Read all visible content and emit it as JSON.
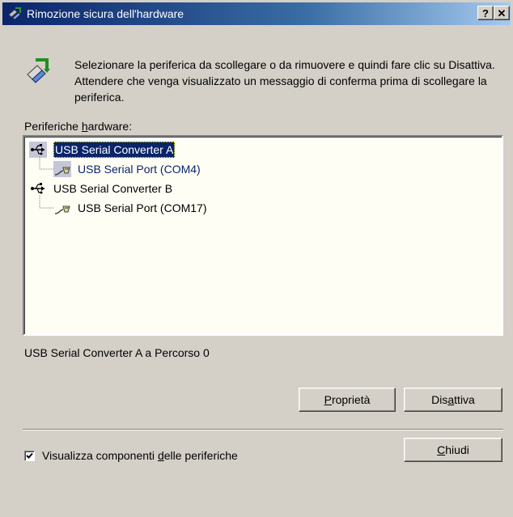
{
  "window": {
    "title": "Rimozione sicura dell'hardware",
    "help_label": "?",
    "close_label": "✕"
  },
  "intro": {
    "text": "Selezionare la periferica da scollegare o da rimuovere e quindi fare clic su Disattiva. Attendere che venga visualizzato un messaggio di conferma prima di scollegare la periferica."
  },
  "list": {
    "label_pre": "Periferiche ",
    "label_ul": "h",
    "label_post": "ardware:",
    "items": [
      {
        "label": "USB Serial Converter A",
        "icon": "usb-plug-icon",
        "selected": true
      },
      {
        "label": "USB Serial Port (COM4)",
        "icon": "serial-port-icon",
        "selected": false
      },
      {
        "label": "USB Serial Converter B",
        "icon": "usb-plug-icon",
        "selected": false
      },
      {
        "label": "USB Serial Port (COM17)",
        "icon": "serial-port-icon",
        "selected": false
      }
    ]
  },
  "status": {
    "text": "USB Serial Converter A a Percorso 0"
  },
  "buttons": {
    "properties_ul": "P",
    "properties_rest": "roprietà",
    "disable_pre": "Dis",
    "disable_ul": "a",
    "disable_post": "ttiva",
    "close_ul": "C",
    "close_rest": "hiudi"
  },
  "checkbox": {
    "checked": true,
    "label_pre": "Visualizza componenti ",
    "label_ul": "d",
    "label_post": "elle periferiche"
  },
  "colors": {
    "titlebar_start": "#0a246a",
    "titlebar_end": "#a6caf0",
    "selection": "#0a246a",
    "face": "#d4d0c8",
    "list_bg": "#fffef5"
  }
}
